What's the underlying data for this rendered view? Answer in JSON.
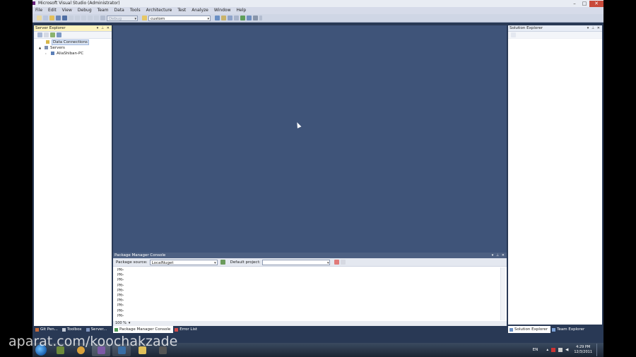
{
  "window": {
    "title": "Microsoft Visual Studio (Administrator)"
  },
  "menu": [
    "File",
    "Edit",
    "View",
    "Debug",
    "Team",
    "Data",
    "Tools",
    "Architecture",
    "Test",
    "Analyze",
    "Window",
    "Help"
  ],
  "toolbar": {
    "config_value": "Debug",
    "search_value": "custom"
  },
  "server_explorer": {
    "title": "Server Explorer",
    "items": [
      {
        "label": "Data Connections",
        "icon": "database-icon",
        "expander": ""
      },
      {
        "label": "Servers",
        "icon": "servers-icon",
        "expander": "▲"
      },
      {
        "label": "AliaShiban-PC",
        "icon": "computer-icon",
        "expander": "▹"
      }
    ]
  },
  "solution_explorer": {
    "title": "Solution Explorer"
  },
  "package_manager": {
    "title": "Package Manager Console",
    "source_label": "Package source:",
    "source_value": "LocalNuget",
    "project_label": "Default project:",
    "project_value": "",
    "prompts": [
      "PM>",
      "PM>",
      "PM>",
      "PM>",
      "PM>",
      "PM>",
      "PM>",
      "PM>",
      "PM>",
      "PM>"
    ],
    "zoom": "100 %"
  },
  "bottom_tabs_left": [
    {
      "label": "Git Pen...",
      "active": false
    },
    {
      "label": "Toolbox",
      "active": false
    },
    {
      "label": "Server...",
      "active": false
    }
  ],
  "bottom_tabs_center": [
    {
      "label": "Package Manager Console",
      "active": true
    },
    {
      "label": "Error List",
      "active": false
    }
  ],
  "bottom_tabs_right": [
    {
      "label": "Solution Explorer",
      "active": true
    },
    {
      "label": "Team Explorer",
      "active": false
    }
  ],
  "taskbar": {
    "apps": [
      {
        "icon": "media-icon",
        "color": "#6c8a3a"
      },
      {
        "icon": "chrome-icon",
        "color": "#d9a13b"
      },
      {
        "icon": "visual-studio-icon",
        "color": "#7d5aa6"
      },
      {
        "icon": "terminal-icon",
        "color": "#3a6ea5"
      },
      {
        "icon": "folder-icon",
        "color": "#e0c05a"
      },
      {
        "icon": "app-icon",
        "color": "#555"
      }
    ],
    "language": "EN",
    "time": "4:29 PM",
    "date": "12/3/2011"
  },
  "watermark": "aparat.com/koochakzade",
  "colors": {
    "editor_bg": "#3f5479",
    "chrome_bg": "#293955",
    "accent_header": "#fdf4bf"
  }
}
